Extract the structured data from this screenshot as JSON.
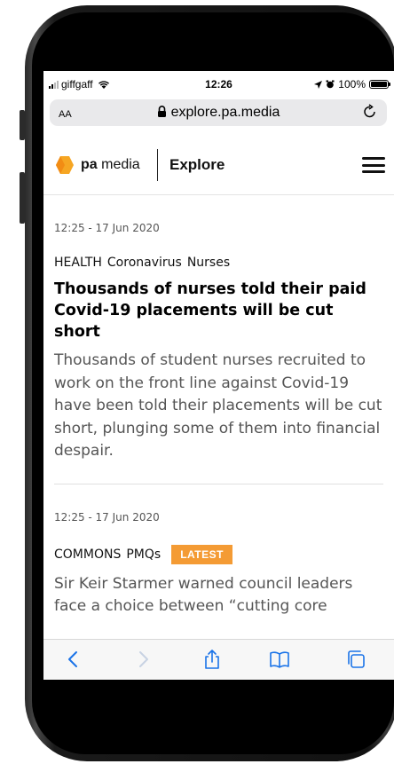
{
  "status_bar": {
    "carrier": "giffgaff",
    "time": "12:26",
    "battery": "100%",
    "icons": [
      "signal-icon",
      "wifi-icon",
      "location-icon",
      "alarm-icon",
      "battery-icon"
    ]
  },
  "browser": {
    "text_size_label": "AA",
    "url": "explore.pa.media",
    "icons": [
      "lock-icon",
      "reload-icon"
    ]
  },
  "site": {
    "logo_bold": "pa",
    "logo_light": "media",
    "section": "Explore",
    "brand_color": "#f6a623"
  },
  "articles": [
    {
      "time": "12:25 - 17 Jun 2020",
      "tags": [
        "HEALTH",
        "Coronavirus",
        "Nurses"
      ],
      "headline": "Thousands of nurses told their paid Covid-19 placements will be cut short",
      "summary": "Thousands of student nurses recruited to work on the front line against Covid-19 have been told their placements will be cut short, plunging some of them into financial despair."
    },
    {
      "time": "12:25 - 17 Jun 2020",
      "tags": [
        "COMMONS",
        "PMQs"
      ],
      "badge": "LATEST",
      "badge_color": "#f49b34",
      "summary": "Sir Keir Starmer warned council leaders face a choice between “cutting core"
    }
  ],
  "toolbar": {
    "icons": [
      "back-icon",
      "forward-icon",
      "share-icon",
      "bookmarks-icon",
      "tabs-icon"
    ]
  }
}
